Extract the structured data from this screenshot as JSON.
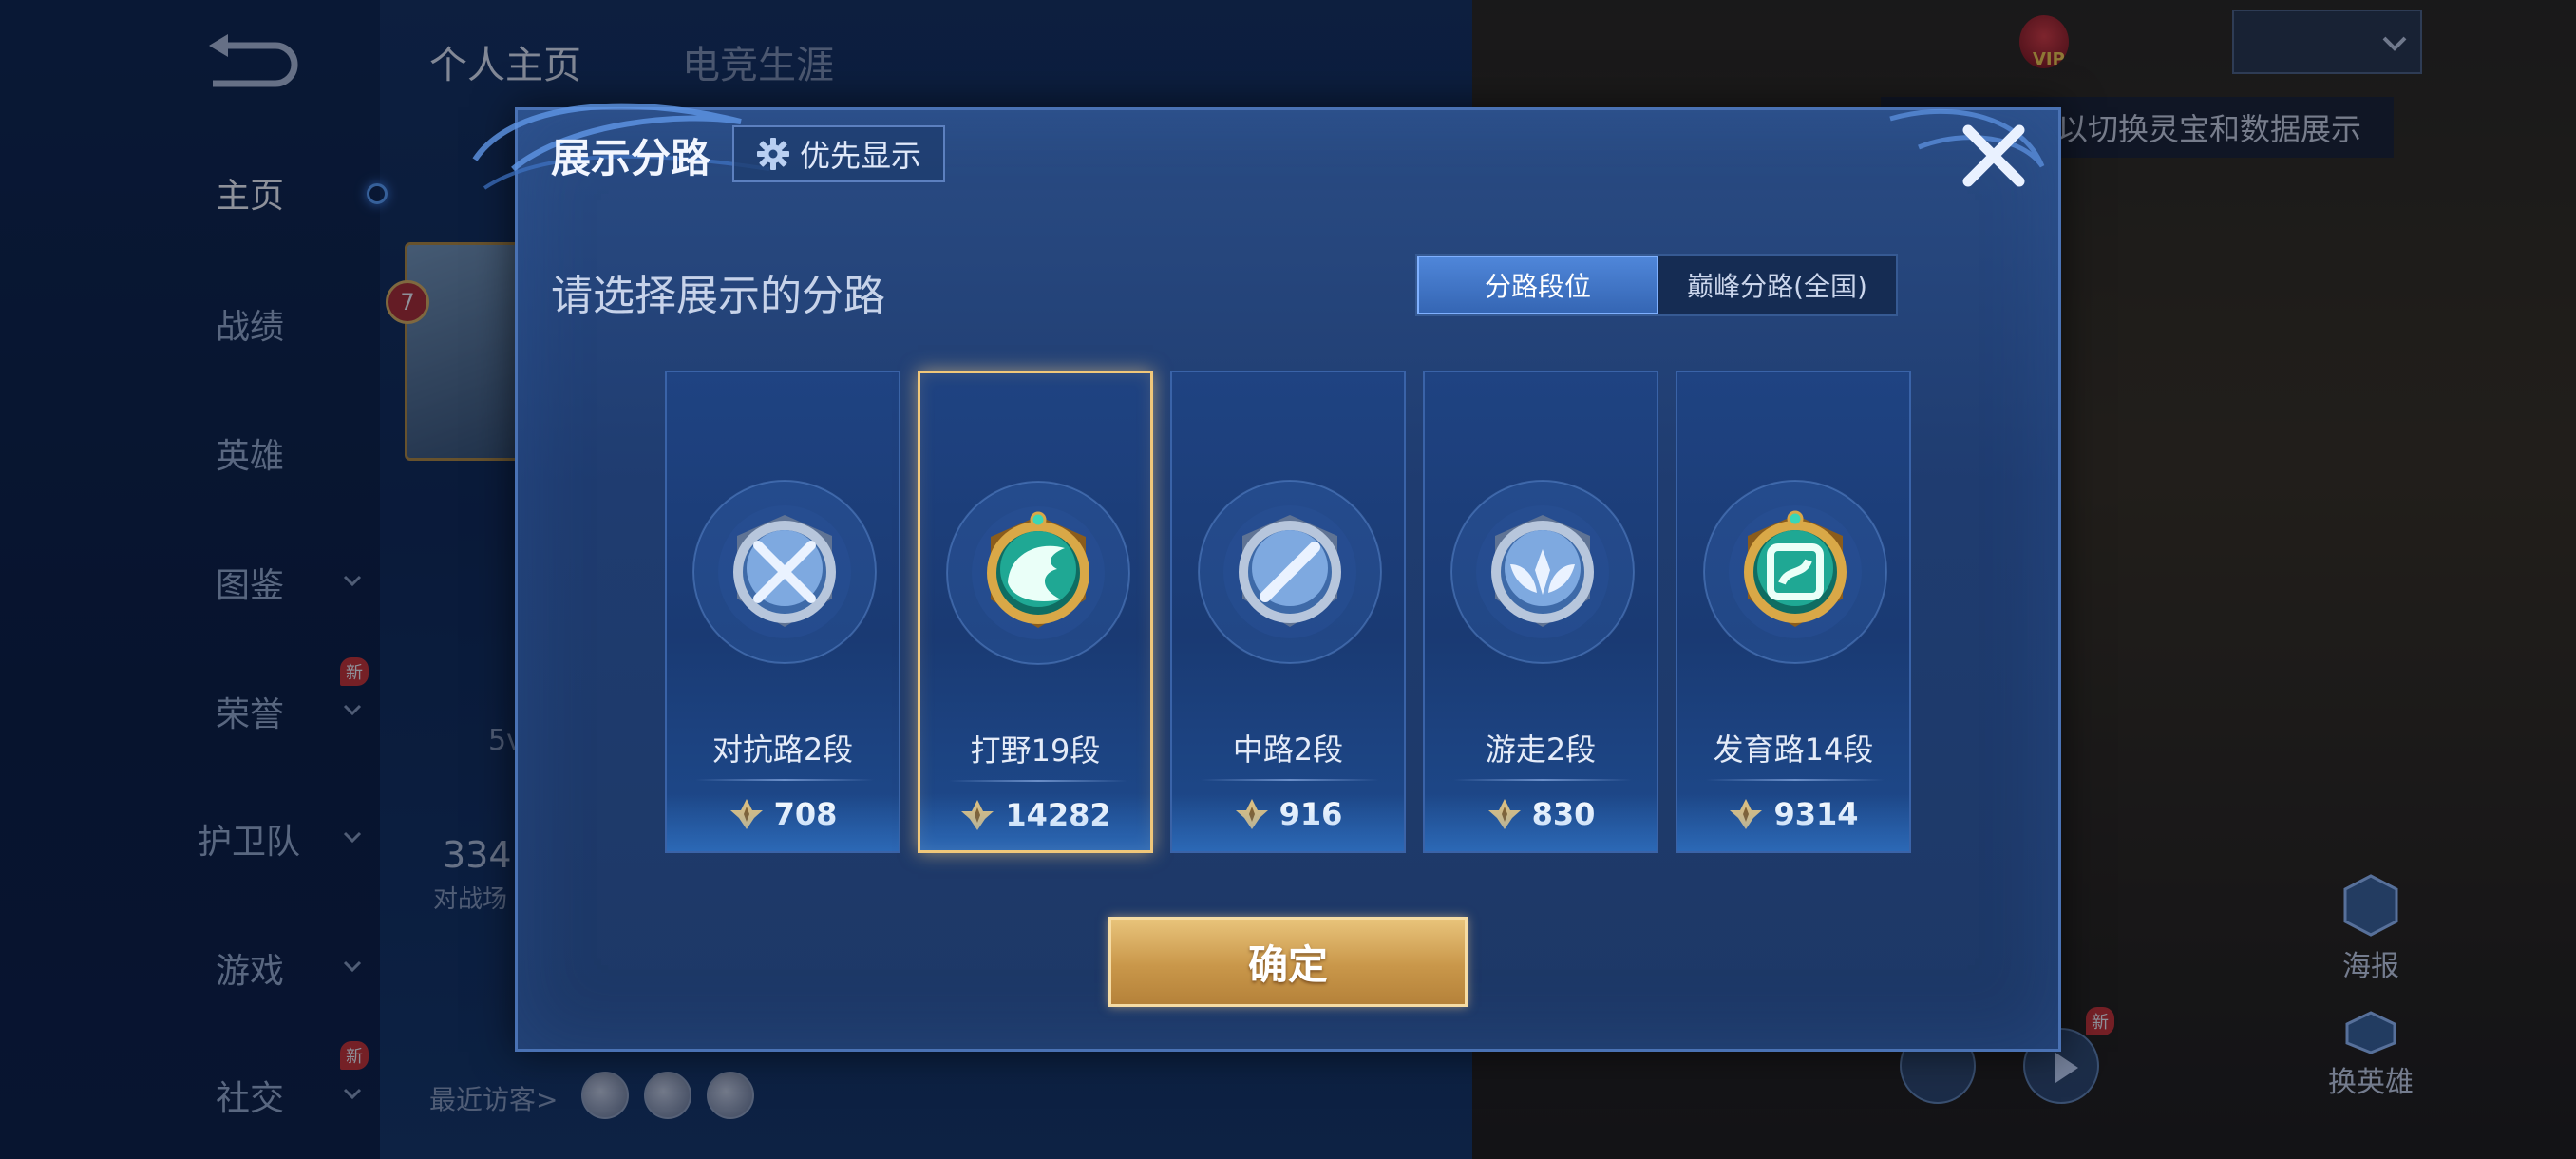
{
  "top_tabs": {
    "profile": "个人主页",
    "career": "电竞生涯"
  },
  "sidebar": {
    "items": [
      {
        "label": "主页",
        "active": true,
        "has_chevron": false,
        "badge": ""
      },
      {
        "label": "战绩",
        "active": false,
        "has_chevron": false,
        "badge": ""
      },
      {
        "label": "英雄",
        "active": false,
        "has_chevron": false,
        "badge": ""
      },
      {
        "label": "图鉴",
        "active": false,
        "has_chevron": true,
        "badge": ""
      },
      {
        "label": "荣誉",
        "active": false,
        "has_chevron": true,
        "badge": "新"
      },
      {
        "label": "护卫队",
        "active": false,
        "has_chevron": true,
        "badge": ""
      },
      {
        "label": "游戏",
        "active": false,
        "has_chevron": true,
        "badge": ""
      },
      {
        "label": "社交",
        "active": false,
        "has_chevron": true,
        "badge": "新"
      }
    ]
  },
  "behind": {
    "level": "7",
    "mode_text": "5v",
    "count_text": "334",
    "count_sub": "对战场",
    "visitors_label": "最近访客>",
    "vip_text": "VIP",
    "hint_text": "以切换灵宝和数据展示",
    "poster_label": "海报",
    "swap_hero_label": "换英雄",
    "right_new_badge": "新"
  },
  "dialog": {
    "title": "展示分路",
    "priority_button": "优先显示",
    "prompt": "请选择展示的分路",
    "toggle": {
      "lane_rank": "分路段位",
      "peak_lane": "巅峰分路(全国)"
    },
    "lanes": [
      {
        "name": "对抗路2段",
        "score": "708",
        "emblem": "sword-cross-silver-emblem-icon"
      },
      {
        "name": "打野19段",
        "score": "14282",
        "emblem": "dragon-gold-emblem-icon"
      },
      {
        "name": "中路2段",
        "score": "916",
        "emblem": "staff-silver-emblem-icon"
      },
      {
        "name": "游走2段",
        "score": "830",
        "emblem": "wings-silver-emblem-icon"
      },
      {
        "name": "发育路14段",
        "score": "9314",
        "emblem": "bow-gold-emblem-icon"
      }
    ],
    "selected_lane": "打野19段",
    "confirm": "确定"
  },
  "colors": {
    "accent_blue": "#4f86d9",
    "gold": "#e8c37a",
    "selected_border": "#f0c77a",
    "badge_red": "#d1322d"
  }
}
